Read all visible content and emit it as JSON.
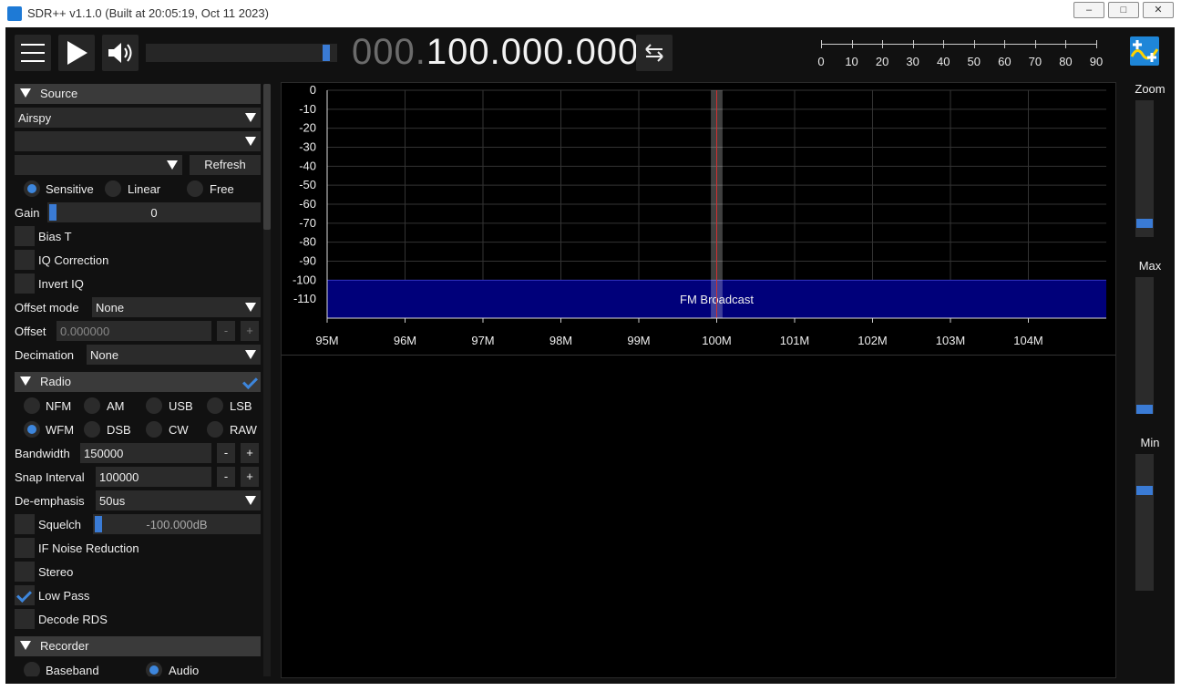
{
  "window": {
    "title": "SDR++ v1.1.0 (Built at 20:05:19, Oct 11 2023)",
    "minimize": "–",
    "maximize": "□",
    "close": "✕"
  },
  "topbar": {
    "menu_icon": "hamburger-icon",
    "play_icon": "play-icon",
    "volume_icon": "speaker-icon",
    "volume_level": 0.97,
    "frequency_dim": "000.",
    "frequency_bright": "100.000.000",
    "swap_icon": "swap-arrows-icon",
    "snr_ticks": [
      "0",
      "10",
      "20",
      "30",
      "40",
      "50",
      "60",
      "70",
      "80",
      "90"
    ]
  },
  "source": {
    "header": "Source",
    "device": "Airspy",
    "device_serial": "",
    "samplerate": "",
    "refresh_label": "Refresh",
    "gain_modes": [
      {
        "label": "Sensitive",
        "selected": true
      },
      {
        "label": "Linear",
        "selected": false
      },
      {
        "label": "Free",
        "selected": false
      }
    ],
    "gain_label": "Gain",
    "gain_value": "0",
    "bias_t": "Bias T",
    "iq_correction": "IQ Correction",
    "invert_iq": "Invert IQ",
    "offset_mode_label": "Offset mode",
    "offset_mode_value": "None",
    "offset_label": "Offset",
    "offset_value": "0.000000",
    "decimation_label": "Decimation",
    "decimation_value": "None",
    "minus": "-",
    "plus": "+"
  },
  "radio": {
    "header": "Radio",
    "modes": [
      {
        "label": "NFM",
        "selected": false
      },
      {
        "label": "AM",
        "selected": false
      },
      {
        "label": "USB",
        "selected": false
      },
      {
        "label": "LSB",
        "selected": false
      },
      {
        "label": "WFM",
        "selected": true
      },
      {
        "label": "DSB",
        "selected": false
      },
      {
        "label": "CW",
        "selected": false
      },
      {
        "label": "RAW",
        "selected": false
      }
    ],
    "bandwidth_label": "Bandwidth",
    "bandwidth_value": "150000",
    "snap_label": "Snap Interval",
    "snap_value": "100000",
    "deemph_label": "De-emphasis",
    "deemph_value": "50us",
    "squelch_label": "Squelch",
    "squelch_value": "-100.000dB",
    "if_nr_label": "IF Noise Reduction",
    "stereo_label": "Stereo",
    "lowpass_label": "Low Pass",
    "rds_label": "Decode RDS"
  },
  "recorder": {
    "header": "Recorder",
    "baseband": "Baseband",
    "audio": "Audio"
  },
  "spectrum": {
    "y_ticks": [
      "0",
      "-10",
      "-20",
      "-30",
      "-40",
      "-50",
      "-60",
      "-70",
      "-80",
      "-90",
      "-100",
      "-110"
    ],
    "y_values": [
      0,
      -10,
      -20,
      -30,
      -40,
      -50,
      -60,
      -70,
      -80,
      -90,
      -100,
      -110
    ],
    "x_ticks": [
      "95M",
      "96M",
      "97M",
      "98M",
      "99M",
      "100M",
      "101M",
      "102M",
      "103M",
      "104M"
    ],
    "x_values": [
      95,
      96,
      97,
      98,
      99,
      100,
      101,
      102,
      103,
      104
    ],
    "band_label": "FM Broadcast",
    "band_range_mhz": [
      95,
      105
    ],
    "band_level_db": [
      -100,
      -120
    ],
    "center_mhz": 100,
    "vfo_width_mhz": 0.15,
    "y_range": [
      -120,
      0
    ],
    "x_range": [
      95,
      105
    ]
  },
  "side_sliders": {
    "zoom_label": "Zoom",
    "max_label": "Max",
    "min_label": "Min",
    "zoom_level": 0.07,
    "max_level": 0.0,
    "min_level": 0.75
  },
  "colors": {
    "accent": "#3d86dc",
    "band": "#00007a",
    "vfo_line": "#d03030"
  }
}
